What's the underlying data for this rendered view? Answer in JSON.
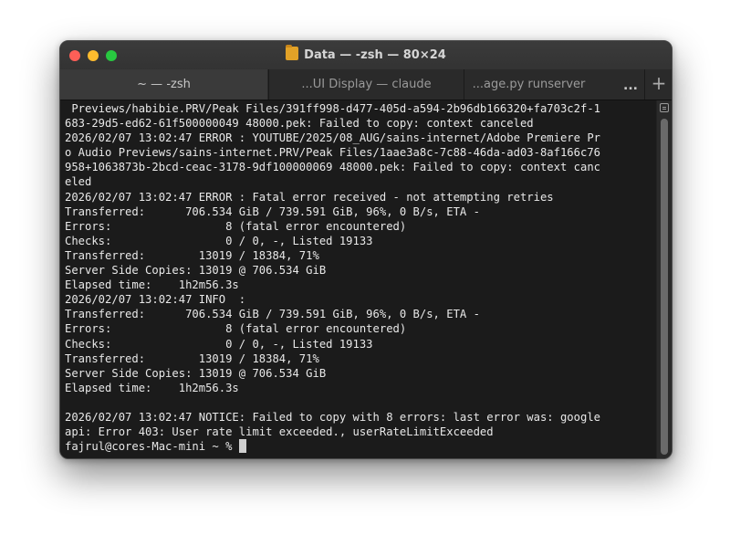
{
  "window": {
    "title": "Data — -zsh — 80×24",
    "folder_icon": "folder-icon"
  },
  "tabs": [
    {
      "label": "~ — -zsh",
      "active": true
    },
    {
      "label": "...UI Display — claude",
      "active": false
    },
    {
      "label": "...age.py runserver",
      "active": false
    }
  ],
  "tab_overflow_label": "...",
  "new_tab_label": "+",
  "terminal": {
    "lines": [
      " Previews/habibie.PRV/Peak Files/391ff998-d477-405d-a594-2b96db166320+fa703c2f-1",
      "683-29d5-ed62-61f500000049 48000.pek: Failed to copy: context canceled",
      "2026/02/07 13:02:47 ERROR : YOUTUBE/2025/08_AUG/sains-internet/Adobe Premiere Pr",
      "o Audio Previews/sains-internet.PRV/Peak Files/1aae3a8c-7c88-46da-ad03-8af166c76",
      "958+1063873b-2bcd-ceac-3178-9df100000069 48000.pek: Failed to copy: context canc",
      "eled",
      "2026/02/07 13:02:47 ERROR : Fatal error received - not attempting retries",
      "Transferred:      706.534 GiB / 739.591 GiB, 96%, 0 B/s, ETA -",
      "Errors:                 8 (fatal error encountered)",
      "Checks:                 0 / 0, -, Listed 19133",
      "Transferred:        13019 / 18384, 71%",
      "Server Side Copies: 13019 @ 706.534 GiB",
      "Elapsed time:    1h2m56.3s",
      "2026/02/07 13:02:47 INFO  :",
      "Transferred:      706.534 GiB / 739.591 GiB, 96%, 0 B/s, ETA -",
      "Errors:                 8 (fatal error encountered)",
      "Checks:                 0 / 0, -, Listed 19133",
      "Transferred:        13019 / 18384, 71%",
      "Server Side Copies: 13019 @ 706.534 GiB",
      "Elapsed time:    1h2m56.3s",
      "",
      "2026/02/07 13:02:47 NOTICE: Failed to copy with 8 errors: last error was: google",
      "api: Error 403: User rate limit exceeded., userRateLimitExceeded"
    ],
    "prompt": "fajrul@cores-Mac-mini ~ % "
  },
  "colors": {
    "close": "#fe5f57",
    "minimize": "#febc2e",
    "zoom": "#28c840",
    "terminal_bg": "#1b1b1b",
    "terminal_fg": "#e8e8e8"
  }
}
